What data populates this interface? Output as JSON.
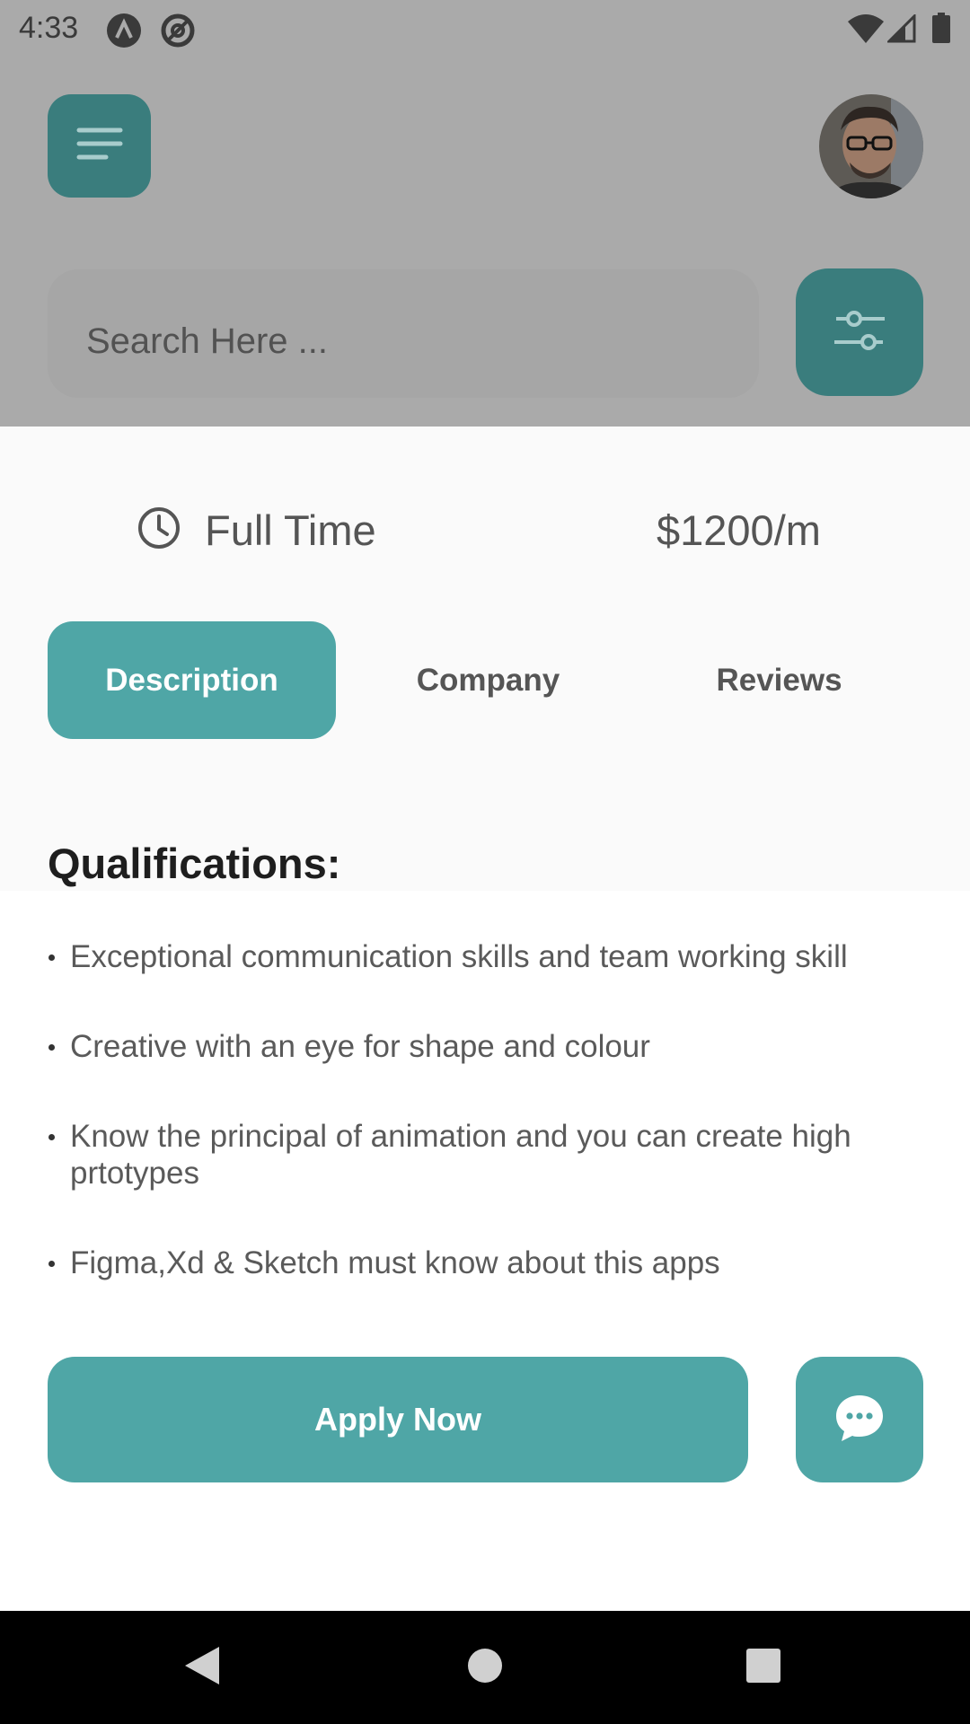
{
  "status_bar": {
    "time": "4:33"
  },
  "header": {
    "menu_icon": "hamburger-icon",
    "avatar_icon": "user-avatar"
  },
  "search": {
    "placeholder": "Search Here ...",
    "filter_icon": "sliders-icon"
  },
  "job": {
    "type_icon": "clock-icon",
    "type": "Full Time",
    "salary": "$1200/m"
  },
  "tabs": [
    {
      "label": "Description",
      "active": true
    },
    {
      "label": "Company",
      "active": false
    },
    {
      "label": "Reviews",
      "active": false
    }
  ],
  "qualifications": {
    "title": "Qualifications:",
    "items": [
      "Exceptional communication skills and team working skill",
      "Creative with an eye for shape and colour",
      "Know the principal of animation and you can create high prtotypes",
      "Figma,Xd & Sketch must know about this apps"
    ]
  },
  "actions": {
    "apply_label": "Apply Now",
    "chat_icon": "chat-bubble-icon"
  },
  "colors": {
    "accent": "#4fa6a6",
    "accent_dimmed": "#3a7d7d",
    "scrim": "#aaaaaa"
  }
}
